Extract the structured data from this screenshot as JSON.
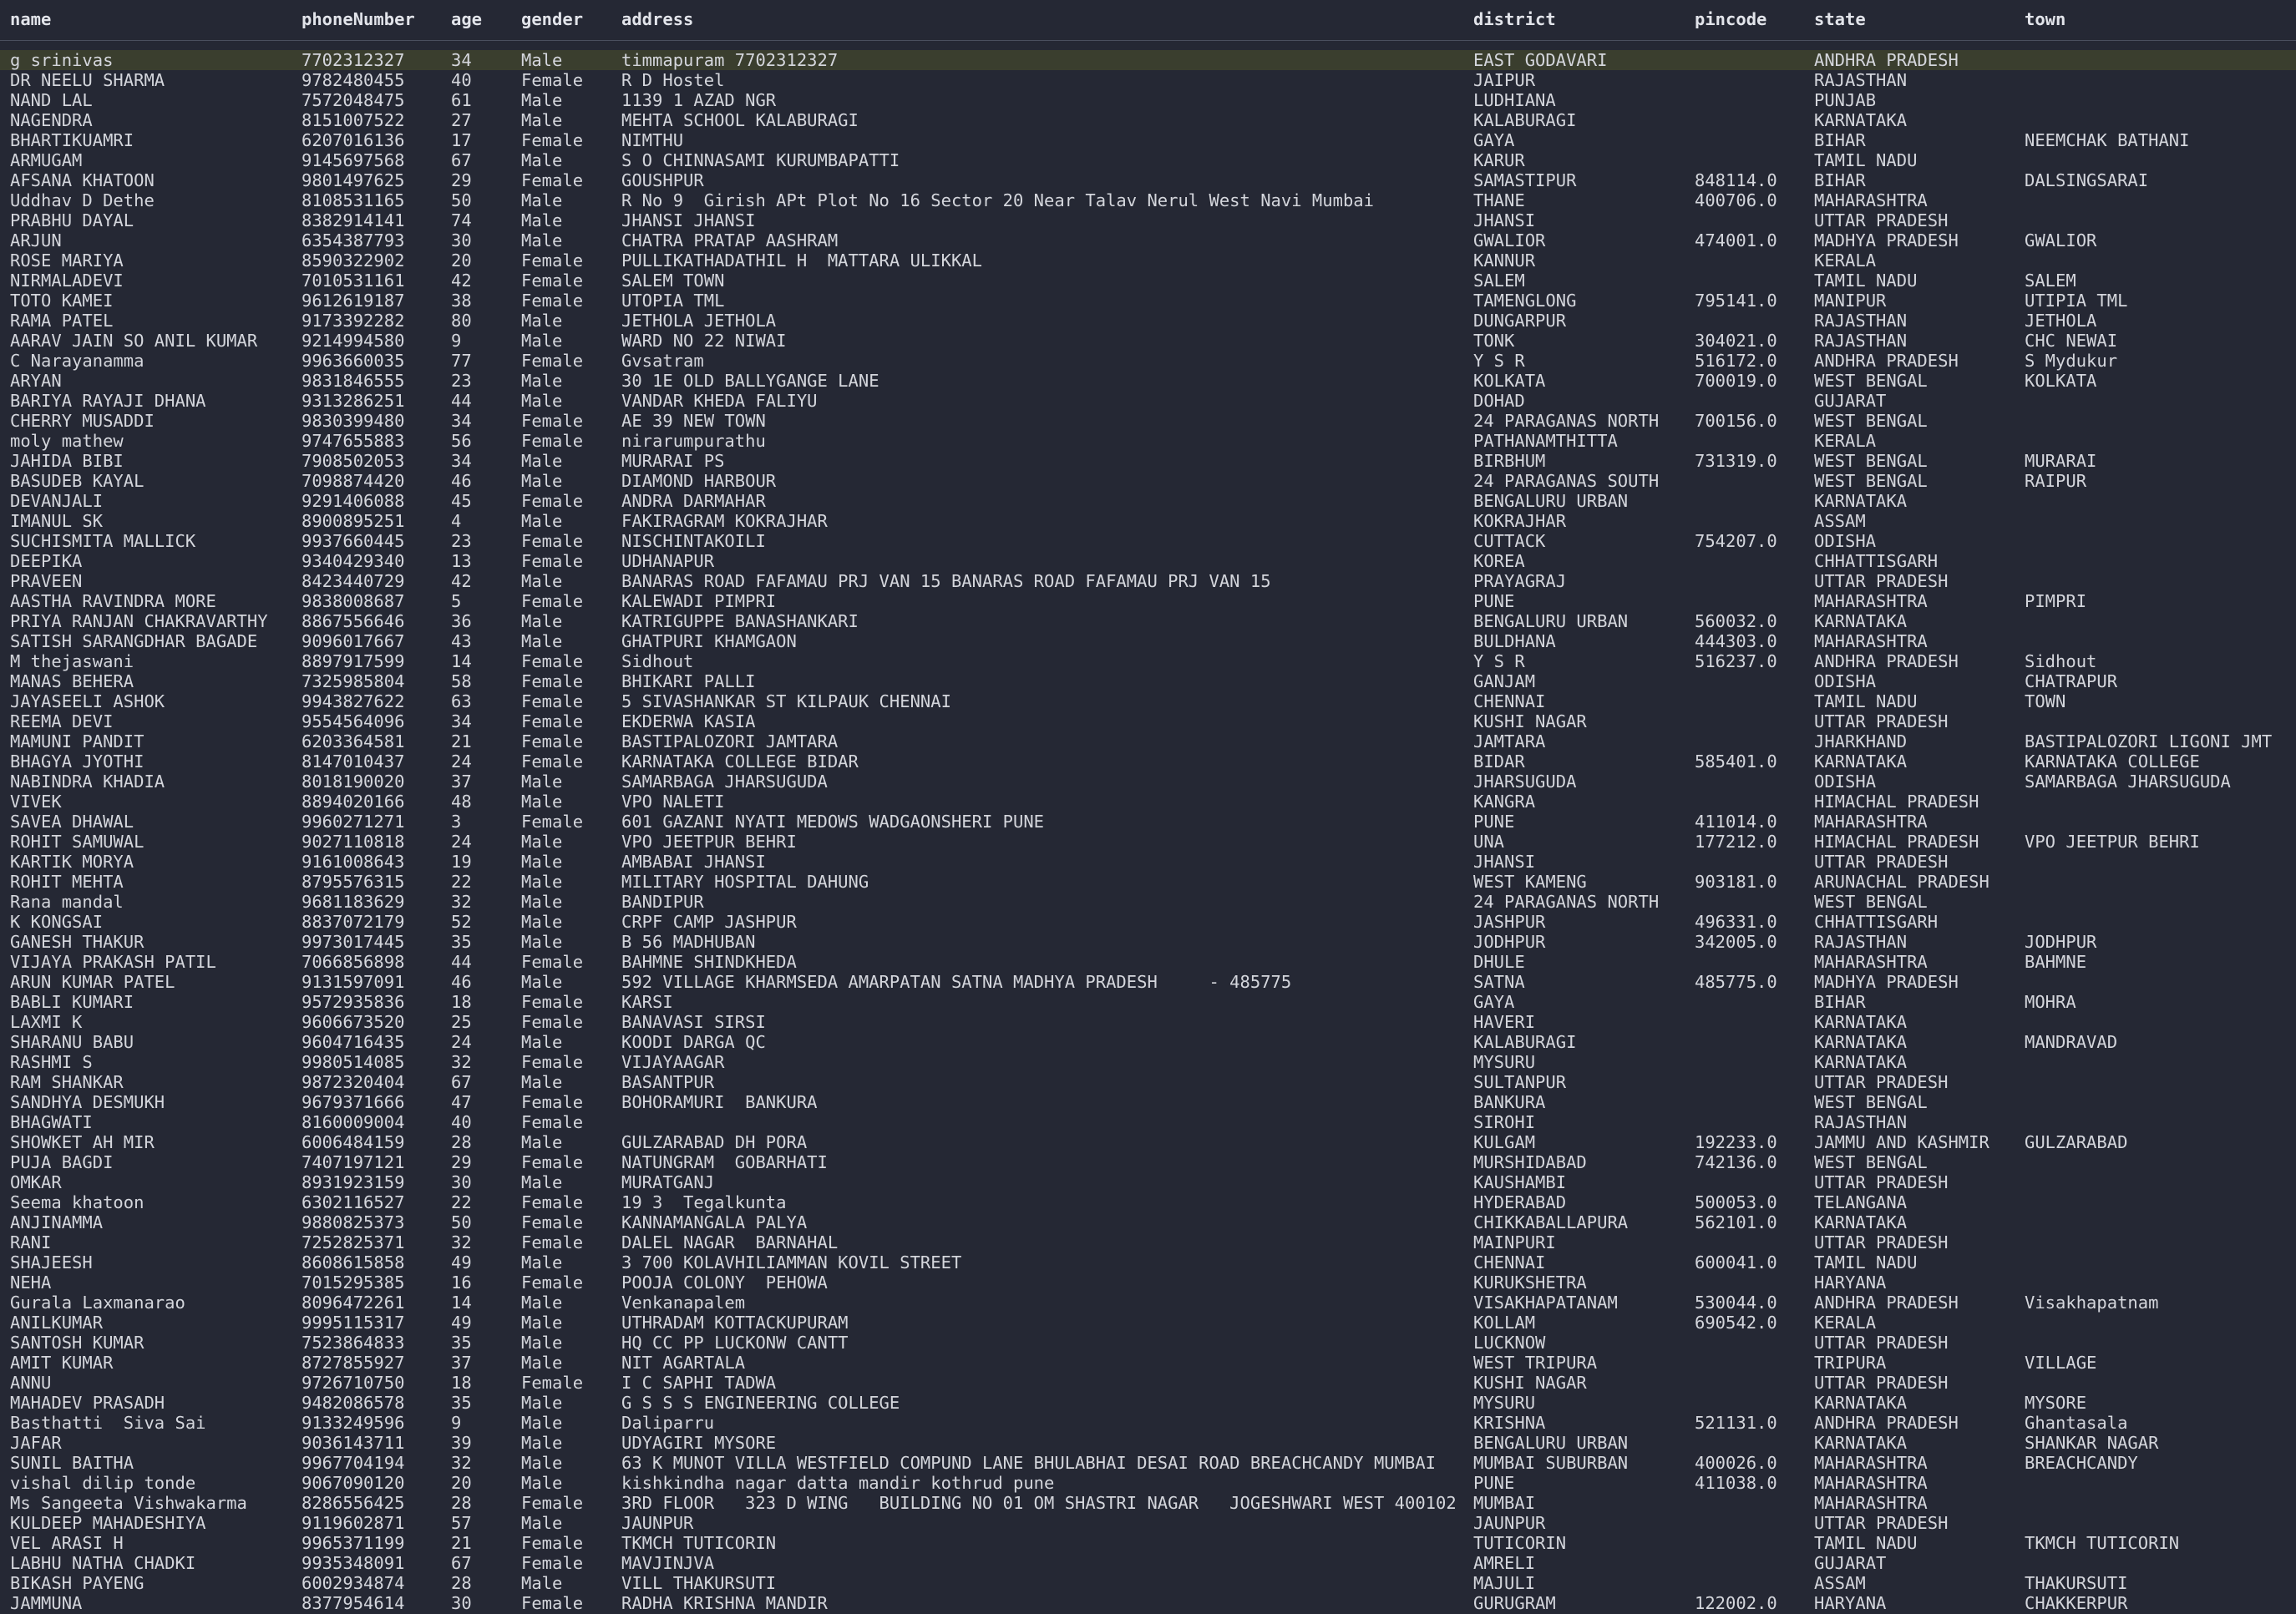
{
  "columns": [
    "name",
    "phoneNumber",
    "age",
    "gender",
    "address",
    "district",
    "pincode",
    "state",
    "town"
  ],
  "selected_row": 0,
  "rows": [
    [
      "g srinivas",
      "7702312327",
      "34",
      "Male",
      "timmapuram 7702312327",
      "EAST GODAVARI",
      "",
      "ANDHRA PRADESH",
      ""
    ],
    [
      "DR NEELU SHARMA",
      "9782480455",
      "40",
      "Female",
      "R D Hostel",
      "JAIPUR",
      "",
      "RAJASTHAN",
      ""
    ],
    [
      "NAND LAL",
      "7572048475",
      "61",
      "Male",
      "1139 1 AZAD NGR",
      "LUDHIANA",
      "",
      "PUNJAB",
      ""
    ],
    [
      "NAGENDRA",
      "8151007522",
      "27",
      "Male",
      "MEHTA SCHOOL KALABURAGI",
      "KALABURAGI",
      "",
      "KARNATAKA",
      ""
    ],
    [
      "BHARTIKUAMRI",
      "6207016136",
      "17",
      "Female",
      "NIMTHU",
      "GAYA",
      "",
      "BIHAR",
      "NEEMCHAK BATHANI"
    ],
    [
      "ARMUGAM",
      "9145697568",
      "67",
      "Male",
      "S O CHINNASAMI KURUMBAPATTI",
      "KARUR",
      "",
      "TAMIL NADU",
      ""
    ],
    [
      "AFSANA KHATOON",
      "9801497625",
      "29",
      "Female",
      "GOUSHPUR",
      "SAMASTIPUR",
      "848114.0",
      "BIHAR",
      "DALSINGSARAI"
    ],
    [
      "Uddhav D Dethe",
      "8108531165",
      "50",
      "Male",
      "R No 9  Girish APt Plot No 16 Sector 20 Near Talav Nerul West Navi Mumbai",
      "THANE",
      "400706.0",
      "MAHARASHTRA",
      ""
    ],
    [
      "PRABHU DAYAL",
      "8382914141",
      "74",
      "Male",
      "JHANSI JHANSI",
      "JHANSI",
      "",
      "UTTAR PRADESH",
      ""
    ],
    [
      "ARJUN",
      "6354387793",
      "30",
      "Male",
      "CHATRA PRATAP AASHRAM",
      "GWALIOR",
      "474001.0",
      "MADHYA PRADESH",
      "GWALIOR"
    ],
    [
      "ROSE MARIYA",
      "8590322902",
      "20",
      "Female",
      "PULLIKATHADATHIL H  MATTARA ULIKKAL",
      "KANNUR",
      "",
      "KERALA",
      ""
    ],
    [
      "NIRMALADEVI",
      "7010531161",
      "42",
      "Female",
      "SALEM TOWN",
      "SALEM",
      "",
      "TAMIL NADU",
      "SALEM"
    ],
    [
      "TOTO KAMEI",
      "9612619187",
      "38",
      "Female",
      "UTOPIA TML",
      "TAMENGLONG",
      "795141.0",
      "MANIPUR",
      "UTIPIA TML"
    ],
    [
      "RAMA PATEL",
      "9173392282",
      "80",
      "Male",
      "JETHOLA JETHOLA",
      "DUNGARPUR",
      "",
      "RAJASTHAN",
      "JETHOLA"
    ],
    [
      "AARAV JAIN SO ANIL KUMAR",
      "9214994580",
      "9",
      "Male",
      "WARD NO 22 NIWAI",
      "TONK",
      "304021.0",
      "RAJASTHAN",
      "CHC NEWAI"
    ],
    [
      "C Narayanamma",
      "9963660035",
      "77",
      "Female",
      "Gvsatram",
      "Y S R",
      "516172.0",
      "ANDHRA PRADESH",
      "S Mydukur"
    ],
    [
      "ARYAN",
      "9831846555",
      "23",
      "Male",
      "30 1E OLD BALLYGANGE LANE",
      "KOLKATA",
      "700019.0",
      "WEST BENGAL",
      "KOLKATA"
    ],
    [
      "BARIYA RAYAJI DHANA",
      "9313286251",
      "44",
      "Male",
      "VANDAR KHEDA FALIYU",
      "DOHAD",
      "",
      "GUJARAT",
      ""
    ],
    [
      "CHERRY MUSADDI",
      "9830399480",
      "34",
      "Female",
      "AE 39 NEW TOWN",
      "24 PARAGANAS NORTH",
      "700156.0",
      "WEST BENGAL",
      ""
    ],
    [
      "moly mathew",
      "9747655883",
      "56",
      "Female",
      "nirarumpurathu",
      "PATHANAMTHITTA",
      "",
      "KERALA",
      ""
    ],
    [
      "JAHIDA BIBI",
      "7908502053",
      "34",
      "Male",
      "MURARAI PS",
      "BIRBHUM",
      "731319.0",
      "WEST BENGAL",
      "MURARAI"
    ],
    [
      "BASUDEB KAYAL",
      "7098874420",
      "46",
      "Male",
      "DIAMOND HARBOUR",
      "24 PARAGANAS SOUTH",
      "",
      "WEST BENGAL",
      "RAIPUR"
    ],
    [
      "DEVANJALI",
      "9291406088",
      "45",
      "Female",
      "ANDRA DARMAHAR",
      "BENGALURU URBAN",
      "",
      "KARNATAKA",
      ""
    ],
    [
      "IMANUL SK",
      "8900895251",
      "4",
      "Male",
      "FAKIRAGRAM KOKRAJHAR",
      "KOKRAJHAR",
      "",
      "ASSAM",
      ""
    ],
    [
      "SUCHISMITA MALLICK",
      "9937660445",
      "23",
      "Female",
      "NISCHINTAKOILI",
      "CUTTACK",
      "754207.0",
      "ODISHA",
      ""
    ],
    [
      "DEEPIKA",
      "9340429340",
      "13",
      "Female",
      "UDHANAPUR",
      "KOREA",
      "",
      "CHHATTISGARH",
      ""
    ],
    [
      "PRAVEEN",
      "8423440729",
      "42",
      "Male",
      "BANARAS ROAD FAFAMAU PRJ VAN 15 BANARAS ROAD FAFAMAU PRJ VAN 15",
      "PRAYAGRAJ",
      "",
      "UTTAR PRADESH",
      ""
    ],
    [
      "AASTHA RAVINDRA MORE",
      "9838008687",
      "5",
      "Female",
      "KALEWADI PIMPRI",
      "PUNE",
      "",
      "MAHARASHTRA",
      "PIMPRI"
    ],
    [
      "PRIYA RANJAN CHAKRAVARTHY",
      "8867556646",
      "36",
      "Male",
      "KATRIGUPPE BANASHANKARI",
      "BENGALURU URBAN",
      "560032.0",
      "KARNATAKA",
      ""
    ],
    [
      "SATISH SARANGDHAR BAGADE",
      "9096017667",
      "43",
      "Male",
      "GHATPURI KHAMGAON",
      "BULDHANA",
      "444303.0",
      "MAHARASHTRA",
      ""
    ],
    [
      "M thejaswani",
      "8897917599",
      "14",
      "Female",
      "Sidhout",
      "Y S R",
      "516237.0",
      "ANDHRA PRADESH",
      "Sidhout"
    ],
    [
      "MANAS BEHERA",
      "7325985804",
      "58",
      "Female",
      "BHIKARI PALLI",
      "GANJAM",
      "",
      "ODISHA",
      "CHATRAPUR"
    ],
    [
      "JAYASEELI ASHOK",
      "9943827622",
      "63",
      "Female",
      "5 SIVASHANKAR ST KILPAUK CHENNAI",
      "CHENNAI",
      "",
      "TAMIL NADU",
      "TOWN"
    ],
    [
      "REEMA DEVI",
      "9554564096",
      "34",
      "Female",
      "EKDERWA KASIA",
      "KUSHI NAGAR",
      "",
      "UTTAR PRADESH",
      ""
    ],
    [
      "MAMUNI PANDIT",
      "6203364581",
      "21",
      "Female",
      "BASTIPALOZORI JAMTARA",
      "JAMTARA",
      "",
      "JHARKHAND",
      "BASTIPALOZORI LIGONI JMT"
    ],
    [
      "BHAGYA JYOTHI",
      "8147010437",
      "24",
      "Female",
      "KARNATAKA COLLEGE BIDAR",
      "BIDAR",
      "585401.0",
      "KARNATAKA",
      "KARNATAKA COLLEGE"
    ],
    [
      "NABINDRA KHADIA",
      "8018190020",
      "37",
      "Male",
      "SAMARBAGA JHARSUGUDA",
      "JHARSUGUDA",
      "",
      "ODISHA",
      "SAMARBAGA JHARSUGUDA"
    ],
    [
      "VIVEK",
      "8894020166",
      "48",
      "Male",
      "VPO NALETI",
      "KANGRA",
      "",
      "HIMACHAL PRADESH",
      ""
    ],
    [
      "SAVEA DHAWAL",
      "9960271271",
      "3",
      "Female",
      "601 GAZANI NYATI MEDOWS WADGAONSHERI PUNE",
      "PUNE",
      "411014.0",
      "MAHARASHTRA",
      ""
    ],
    [
      "ROHIT SAMUWAL",
      "9027110818",
      "24",
      "Male",
      "VPO JEETPUR BEHRI",
      "UNA",
      "177212.0",
      "HIMACHAL PRADESH",
      "VPO JEETPUR BEHRI"
    ],
    [
      "KARTIK MORYA",
      "9161008643",
      "19",
      "Male",
      "AMBABAI JHANSI",
      "JHANSI",
      "",
      "UTTAR PRADESH",
      ""
    ],
    [
      "ROHIT MEHTA",
      "8795576315",
      "22",
      "Male",
      "MILITARY HOSPITAL DAHUNG",
      "WEST KAMENG",
      "903181.0",
      "ARUNACHAL PRADESH",
      ""
    ],
    [
      "Rana mandal",
      "9681183629",
      "32",
      "Male",
      "BANDIPUR",
      "24 PARAGANAS NORTH",
      "",
      "WEST BENGAL",
      ""
    ],
    [
      "K KONGSAI",
      "8837072179",
      "52",
      "Male",
      "CRPF CAMP JASHPUR",
      "JASHPUR",
      "496331.0",
      "CHHATTISGARH",
      ""
    ],
    [
      "GANESH THAKUR",
      "9973017445",
      "35",
      "Male",
      "B 56 MADHUBAN",
      "JODHPUR",
      "342005.0",
      "RAJASTHAN",
      "JODHPUR"
    ],
    [
      "VIJAYA PRAKASH PATIL",
      "7066856898",
      "44",
      "Female",
      "BAHMNE SHINDKHEDA",
      "DHULE",
      "",
      "MAHARASHTRA",
      "BAHMNE"
    ],
    [
      "ARUN KUMAR PATEL",
      "9131597091",
      "46",
      "Male",
      "592 VILLAGE KHARMSEDA AMARPATAN SATNA MADHYA PRADESH     - 485775",
      "SATNA",
      "485775.0",
      "MADHYA PRADESH",
      ""
    ],
    [
      "BABLI KUMARI",
      "9572935836",
      "18",
      "Female",
      "KARSI",
      "GAYA",
      "",
      "BIHAR",
      "MOHRA"
    ],
    [
      "LAXMI K",
      "9606673520",
      "25",
      "Female",
      "BANAVASI SIRSI",
      "HAVERI",
      "",
      "KARNATAKA",
      ""
    ],
    [
      "SHARANU BABU",
      "9604716435",
      "24",
      "Male",
      "KOODI DARGA QC",
      "KALABURAGI",
      "",
      "KARNATAKA",
      "MANDRAVAD"
    ],
    [
      "RASHMI S",
      "9980514085",
      "32",
      "Female",
      "VIJAYAAGAR",
      "MYSURU",
      "",
      "KARNATAKA",
      ""
    ],
    [
      "RAM SHANKAR",
      "9872320404",
      "67",
      "Male",
      "BASANTPUR",
      "SULTANPUR",
      "",
      "UTTAR PRADESH",
      ""
    ],
    [
      "SANDHYA DESMUKH",
      "9679371666",
      "47",
      "Female",
      "BOHORAMURI  BANKURA",
      "BANKURA",
      "",
      "WEST BENGAL",
      ""
    ],
    [
      "BHAGWATI",
      "8160009004",
      "40",
      "Female",
      "",
      "SIROHI",
      "",
      "RAJASTHAN",
      ""
    ],
    [
      "SHOWKET AH MIR",
      "6006484159",
      "28",
      "Male",
      "GULZARABAD DH PORA",
      "KULGAM",
      "192233.0",
      "JAMMU AND KASHMIR",
      "GULZARABAD"
    ],
    [
      "PUJA BAGDI",
      "7407197121",
      "29",
      "Female",
      "NATUNGRAM  GOBARHATI",
      "MURSHIDABAD",
      "742136.0",
      "WEST BENGAL",
      ""
    ],
    [
      "OMKAR",
      "8931923159",
      "30",
      "Male",
      "MURATGANJ",
      "KAUSHAMBI",
      "",
      "UTTAR PRADESH",
      ""
    ],
    [
      "Seema khatoon",
      "6302116527",
      "22",
      "Female",
      "19 3  Tegalkunta",
      "HYDERABAD",
      "500053.0",
      "TELANGANA",
      ""
    ],
    [
      "ANJINAMMA",
      "9880825373",
      "50",
      "Female",
      "KANNAMANGALA PALYA",
      "CHIKKABALLAPURA",
      "562101.0",
      "KARNATAKA",
      ""
    ],
    [
      "RANI",
      "7252825371",
      "32",
      "Female",
      "DALEL NAGAR  BARNAHAL",
      "MAINPURI",
      "",
      "UTTAR PRADESH",
      ""
    ],
    [
      "SHAJEESH",
      "8608615858",
      "49",
      "Male",
      "3 700 KOLAVHILIAMMAN KOVIL STREET",
      "CHENNAI",
      "600041.0",
      "TAMIL NADU",
      ""
    ],
    [
      "NEHA",
      "7015295385",
      "16",
      "Female",
      "POOJA COLONY  PEHOWA",
      "KURUKSHETRA",
      "",
      "HARYANA",
      ""
    ],
    [
      "Gurala Laxmanarao",
      "8096472261",
      "14",
      "Male",
      "Venkanapalem",
      "VISAKHAPATANAM",
      "530044.0",
      "ANDHRA PRADESH",
      "Visakhapatnam"
    ],
    [
      "ANILKUMAR",
      "9995115317",
      "49",
      "Male",
      "UTHRADAM KOTTACKUPURAM",
      "KOLLAM",
      "690542.0",
      "KERALA",
      ""
    ],
    [
      "SANTOSH KUMAR",
      "7523864833",
      "35",
      "Male",
      "HQ CC PP LUCKONW CANTT",
      "LUCKNOW",
      "",
      "UTTAR PRADESH",
      ""
    ],
    [
      "AMIT KUMAR",
      "8727855927",
      "37",
      "Male",
      "NIT AGARTALA",
      "WEST TRIPURA",
      "",
      "TRIPURA",
      "VILLAGE"
    ],
    [
      "ANNU",
      "9726710750",
      "18",
      "Female",
      "I C SAPHI TADWA",
      "KUSHI NAGAR",
      "",
      "UTTAR PRADESH",
      ""
    ],
    [
      "MAHADEV PRASADH",
      "9482086578",
      "35",
      "Male",
      "G S S S ENGINEERING COLLEGE",
      "MYSURU",
      "",
      "KARNATAKA",
      "MYSORE"
    ],
    [
      "Basthatti  Siva Sai",
      "9133249596",
      "9",
      "Male",
      "Daliparru",
      "KRISHNA",
      "521131.0",
      "ANDHRA PRADESH",
      "Ghantasala"
    ],
    [
      "JAFAR",
      "9036143711",
      "39",
      "Male",
      "UDYAGIRI MYSORE",
      "BENGALURU URBAN",
      "",
      "KARNATAKA",
      "SHANKAR NAGAR"
    ],
    [
      "SUNIL BAITHA",
      "9967704194",
      "32",
      "Male",
      "63 K MUNOT VILLA WESTFIELD COMPUND LANE BHULABHAI DESAI ROAD BREACHCANDY MUMBAI",
      "MUMBAI SUBURBAN",
      "400026.0",
      "MAHARASHTRA",
      "BREACHCANDY"
    ],
    [
      "vishal dilip tonde",
      "9067090120",
      "20",
      "Male",
      "kishkindha nagar datta mandir kothrud pune",
      "PUNE",
      "411038.0",
      "MAHARASHTRA",
      ""
    ],
    [
      "Ms Sangeeta Vishwakarma",
      "8286556425",
      "28",
      "Female",
      "3RD FLOOR   323 D WING   BUILDING NO 01 OM SHASTRI NAGAR   JOGESHWARI WEST 400102",
      "MUMBAI",
      "",
      "MAHARASHTRA",
      ""
    ],
    [
      "KULDEEP MAHADESHIYA",
      "9119602871",
      "57",
      "Male",
      "JAUNPUR",
      "JAUNPUR",
      "",
      "UTTAR PRADESH",
      ""
    ],
    [
      "VEL ARASI H",
      "9965371199",
      "21",
      "Female",
      "TKMCH TUTICORIN",
      "TUTICORIN",
      "",
      "TAMIL NADU",
      "TKMCH TUTICORIN"
    ],
    [
      "LABHU NATHA CHADKI",
      "9935348091",
      "67",
      "Female",
      "MAVJINJVA",
      "AMRELI",
      "",
      "GUJARAT",
      ""
    ],
    [
      "BIKASH PAYENG",
      "6002934874",
      "28",
      "Male",
      "VILL THAKURSUTI",
      "MAJULI",
      "",
      "ASSAM",
      "THAKURSUTI"
    ],
    [
      "JAMMUNA",
      "8377954614",
      "30",
      "Female",
      "RADHA KRISHNA MANDIR",
      "GURUGRAM",
      "122002.0",
      "HARYANA",
      "CHAKKERPUR"
    ]
  ]
}
